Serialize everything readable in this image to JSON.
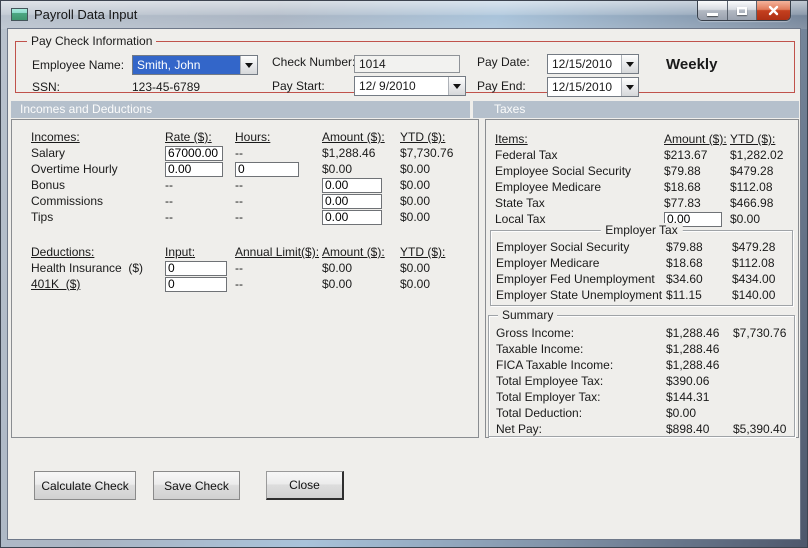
{
  "window": {
    "title": "Payroll Data Input"
  },
  "paycheck": {
    "group_label": "Pay Check Information",
    "employee_name_label": "Employee Name:",
    "employee_name_value": "Smith, John",
    "ssn_label": "SSN:",
    "ssn_value": "123-45-6789",
    "check_number_label": "Check Number:",
    "check_number_value": "1014",
    "pay_start_label": "Pay Start:",
    "pay_start_value": "12/ 9/2010",
    "pay_date_label": "Pay Date:",
    "pay_date_value": "12/15/2010",
    "pay_end_label": "Pay End:",
    "pay_end_value": "12/15/2010",
    "frequency": "Weekly"
  },
  "sections": {
    "incomes_header": "Incomes and Deductions",
    "taxes_header": "Taxes"
  },
  "incomes": {
    "headers": [
      "Incomes:",
      "Rate ($):",
      "Hours:",
      "Amount ($):",
      "YTD ($):"
    ],
    "rows": [
      {
        "label": "Salary",
        "rate": "67000.00",
        "hours": "--",
        "amount": "$1,288.46",
        "ytd": "$7,730.76"
      },
      {
        "label": "Overtime Hourly",
        "rate": "0.00",
        "hours": "0",
        "amount": "$0.00",
        "ytd": "$0.00"
      },
      {
        "label": "Bonus",
        "rate": "--",
        "hours": "--",
        "amount": "0.00",
        "ytd": "$0.00"
      },
      {
        "label": "Commissions",
        "rate": "--",
        "hours": "--",
        "amount": "0.00",
        "ytd": "$0.00"
      },
      {
        "label": "Tips",
        "rate": "--",
        "hours": "--",
        "amount": "0.00",
        "ytd": "$0.00"
      }
    ]
  },
  "deductions": {
    "headers": [
      "Deductions:",
      "Input:",
      "Annual Limit($):",
      "Amount ($):",
      "YTD ($):"
    ],
    "rows": [
      {
        "label": "Health Insurance  ($)",
        "input": "0",
        "limit": "--",
        "amount": "$0.00",
        "ytd": "$0.00"
      },
      {
        "label": "401K  ($)",
        "input": "0",
        "limit": "--",
        "amount": "$0.00",
        "ytd": "$0.00"
      }
    ]
  },
  "taxes": {
    "headers": [
      "Items:",
      "Amount ($):",
      "YTD ($):"
    ],
    "rows": [
      {
        "label": "Federal Tax",
        "amount": "$213.67",
        "ytd": "$1,282.02"
      },
      {
        "label": "Employee Social Security",
        "amount": "$79.88",
        "ytd": "$479.28"
      },
      {
        "label": "Employee Medicare",
        "amount": "$18.68",
        "ytd": "$112.08"
      },
      {
        "label": "State Tax",
        "amount": "$77.83",
        "ytd": "$466.98"
      },
      {
        "label": "Local Tax",
        "amount": "0.00",
        "ytd": "$0.00"
      }
    ],
    "employer_group_label": "Employer Tax",
    "employer_rows": [
      {
        "label": "Employer Social Security",
        "amount": "$79.88",
        "ytd": "$479.28"
      },
      {
        "label": "Employer Medicare",
        "amount": "$18.68",
        "ytd": "$112.08"
      },
      {
        "label": "Employer Fed Unemployment",
        "amount": "$34.60",
        "ytd": "$434.00"
      },
      {
        "label": "Employer State Unemployment",
        "amount": "$11.15",
        "ytd": "$140.00"
      }
    ]
  },
  "summary": {
    "group_label": "Summary",
    "rows": [
      {
        "label": "Gross Income:",
        "amount": "$1,288.46",
        "ytd": "$7,730.76"
      },
      {
        "label": "Taxable Income:",
        "amount": "$1,288.46",
        "ytd": ""
      },
      {
        "label": "FICA Taxable Income:",
        "amount": "$1,288.46",
        "ytd": ""
      },
      {
        "label": "Total Employee Tax:",
        "amount": "$390.06",
        "ytd": ""
      },
      {
        "label": "Total Employer Tax:",
        "amount": "$144.31",
        "ytd": ""
      },
      {
        "label": "Total Deduction:",
        "amount": "$0.00",
        "ytd": ""
      },
      {
        "label": "Net Pay:",
        "amount": "$898.40",
        "ytd": "$5,390.40"
      }
    ]
  },
  "buttons": {
    "calculate": "Calculate Check",
    "save": "Save Check",
    "close": "Close"
  },
  "colors": {
    "groupbox_red": "#c0524b",
    "section_band": "#b5c0cc",
    "selection_blue": "#3366c9",
    "close_button_red": "#c4401f"
  }
}
